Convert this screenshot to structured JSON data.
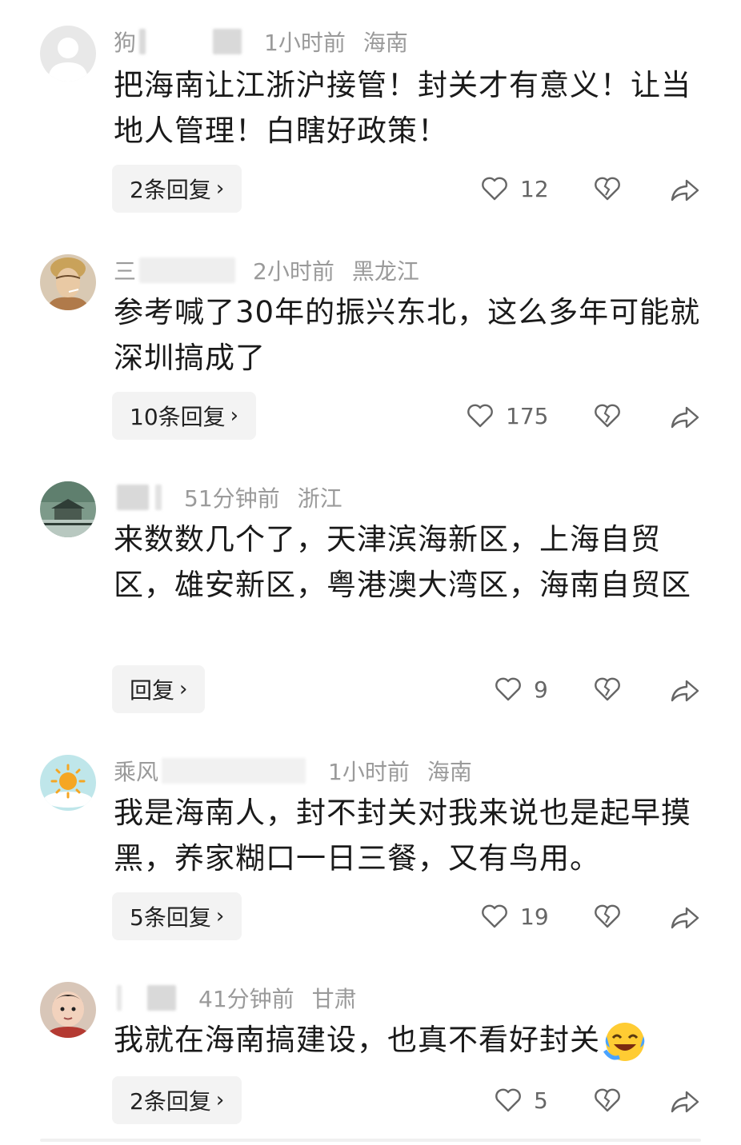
{
  "comments": [
    {
      "name": "狗",
      "time": "1小时前",
      "location": "海南",
      "text": "把海南让江浙沪接管！封关才有意义！让当地人管理！白瞎好政策！",
      "reply_label": "2条回复",
      "likes": "12",
      "avatar": "default-user-avatar"
    },
    {
      "name": "三",
      "time": "2小时前",
      "location": "黑龙江",
      "text": "参考喊了30年的振兴东北，这么多年可能就深圳搞成了",
      "reply_label": "10条回复",
      "likes": "175",
      "avatar": "smoking-person-avatar"
    },
    {
      "name": "",
      "time": "51分钟前",
      "location": "浙江",
      "text": "来数数几个了，天津滨海新区，上海自贸区，雄安新区，粤港澳大湾区，海南自贸区",
      "reply_label": "回复",
      "likes": "9",
      "avatar": "pavilion-landscape-avatar"
    },
    {
      "name": "乘风",
      "time": "1小时前",
      "location": "海南",
      "text": "我是海南人，封不封关对我来说也是起早摸黑，养家糊口一日三餐，又有鸟用。",
      "reply_label": "5条回复",
      "likes": "19",
      "avatar": "sun-illustration-avatar"
    },
    {
      "name": "",
      "time": "41分钟前",
      "location": "甘肃",
      "text": "我就在海南搞建设，也真不看好封关",
      "reply_label": "2条回复",
      "likes": "5",
      "avatar": "baby-photo-avatar",
      "emoji": "laughing-crying-emoji"
    }
  ],
  "icons": {
    "like": "heart-outline-icon",
    "dislike": "broken-heart-icon",
    "share": "share-arrow-icon",
    "chevron": "chevron-right-icon"
  },
  "chevron_glyph": "›"
}
